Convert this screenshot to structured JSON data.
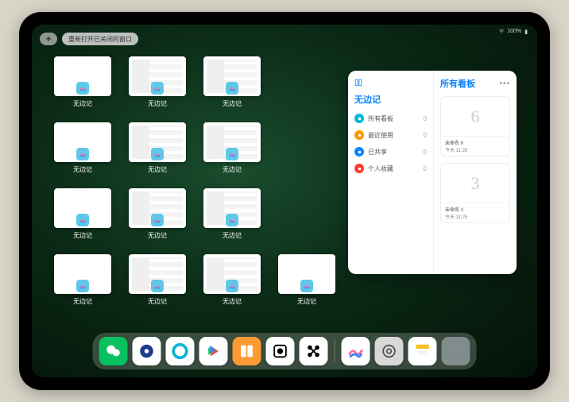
{
  "status": {
    "battery": "100%",
    "wifi": "wifi"
  },
  "top": {
    "plus": "+",
    "reopen_label": "重新打开已关闭的窗口"
  },
  "apps": [
    {
      "name": "无边记",
      "variant": "simple"
    },
    {
      "name": "无边记",
      "variant": "complex"
    },
    {
      "name": "无边记",
      "variant": "complex"
    },
    {
      "name": "无边记",
      "variant": "simple"
    },
    {
      "name": "无边记",
      "variant": "complex"
    },
    {
      "name": "无边记",
      "variant": "complex"
    },
    {
      "name": "无边记",
      "variant": "simple"
    },
    {
      "name": "无边记",
      "variant": "complex"
    },
    {
      "name": "无边记",
      "variant": "complex"
    },
    {
      "name": "无边记",
      "variant": "simple"
    },
    {
      "name": "无边记",
      "variant": "complex"
    },
    {
      "name": "无边记",
      "variant": "complex"
    },
    {
      "name": "无边记",
      "variant": "simple"
    }
  ],
  "panel": {
    "sidebar_icon": "layout",
    "app_title": "无边记",
    "right_title": "所有看板",
    "filters": [
      {
        "label": "所有看板",
        "count": 0,
        "color": "#00bcd4"
      },
      {
        "label": "最近使用",
        "count": 0,
        "color": "#ff9500"
      },
      {
        "label": "已共享",
        "count": 0,
        "color": "#0a84ff"
      },
      {
        "label": "个人收藏",
        "count": 0,
        "color": "#ff3b30"
      }
    ],
    "boards": [
      {
        "title": "未命名 6",
        "subtitle": "今天 11:26",
        "glyph": "6"
      },
      {
        "title": "未命名 3",
        "subtitle": "今天 11:25",
        "glyph": "3"
      }
    ]
  },
  "dock": {
    "icons": [
      {
        "name": "wechat",
        "bg": "#07c160"
      },
      {
        "name": "quark-blue",
        "bg": "#ffffff"
      },
      {
        "name": "quark-cyan",
        "bg": "#ffffff"
      },
      {
        "name": "play-video",
        "bg": "#ffffff"
      },
      {
        "name": "books",
        "bg": "#ff9933"
      },
      {
        "name": "dice",
        "bg": "#ffffff"
      },
      {
        "name": "connect",
        "bg": "#ffffff"
      }
    ],
    "recent": [
      {
        "name": "freeform",
        "bg": "#ffffff"
      },
      {
        "name": "settings",
        "bg": "#d8d8d8"
      },
      {
        "name": "notes",
        "bg": "#ffffff"
      },
      {
        "name": "folder",
        "bg": "folder"
      }
    ]
  }
}
